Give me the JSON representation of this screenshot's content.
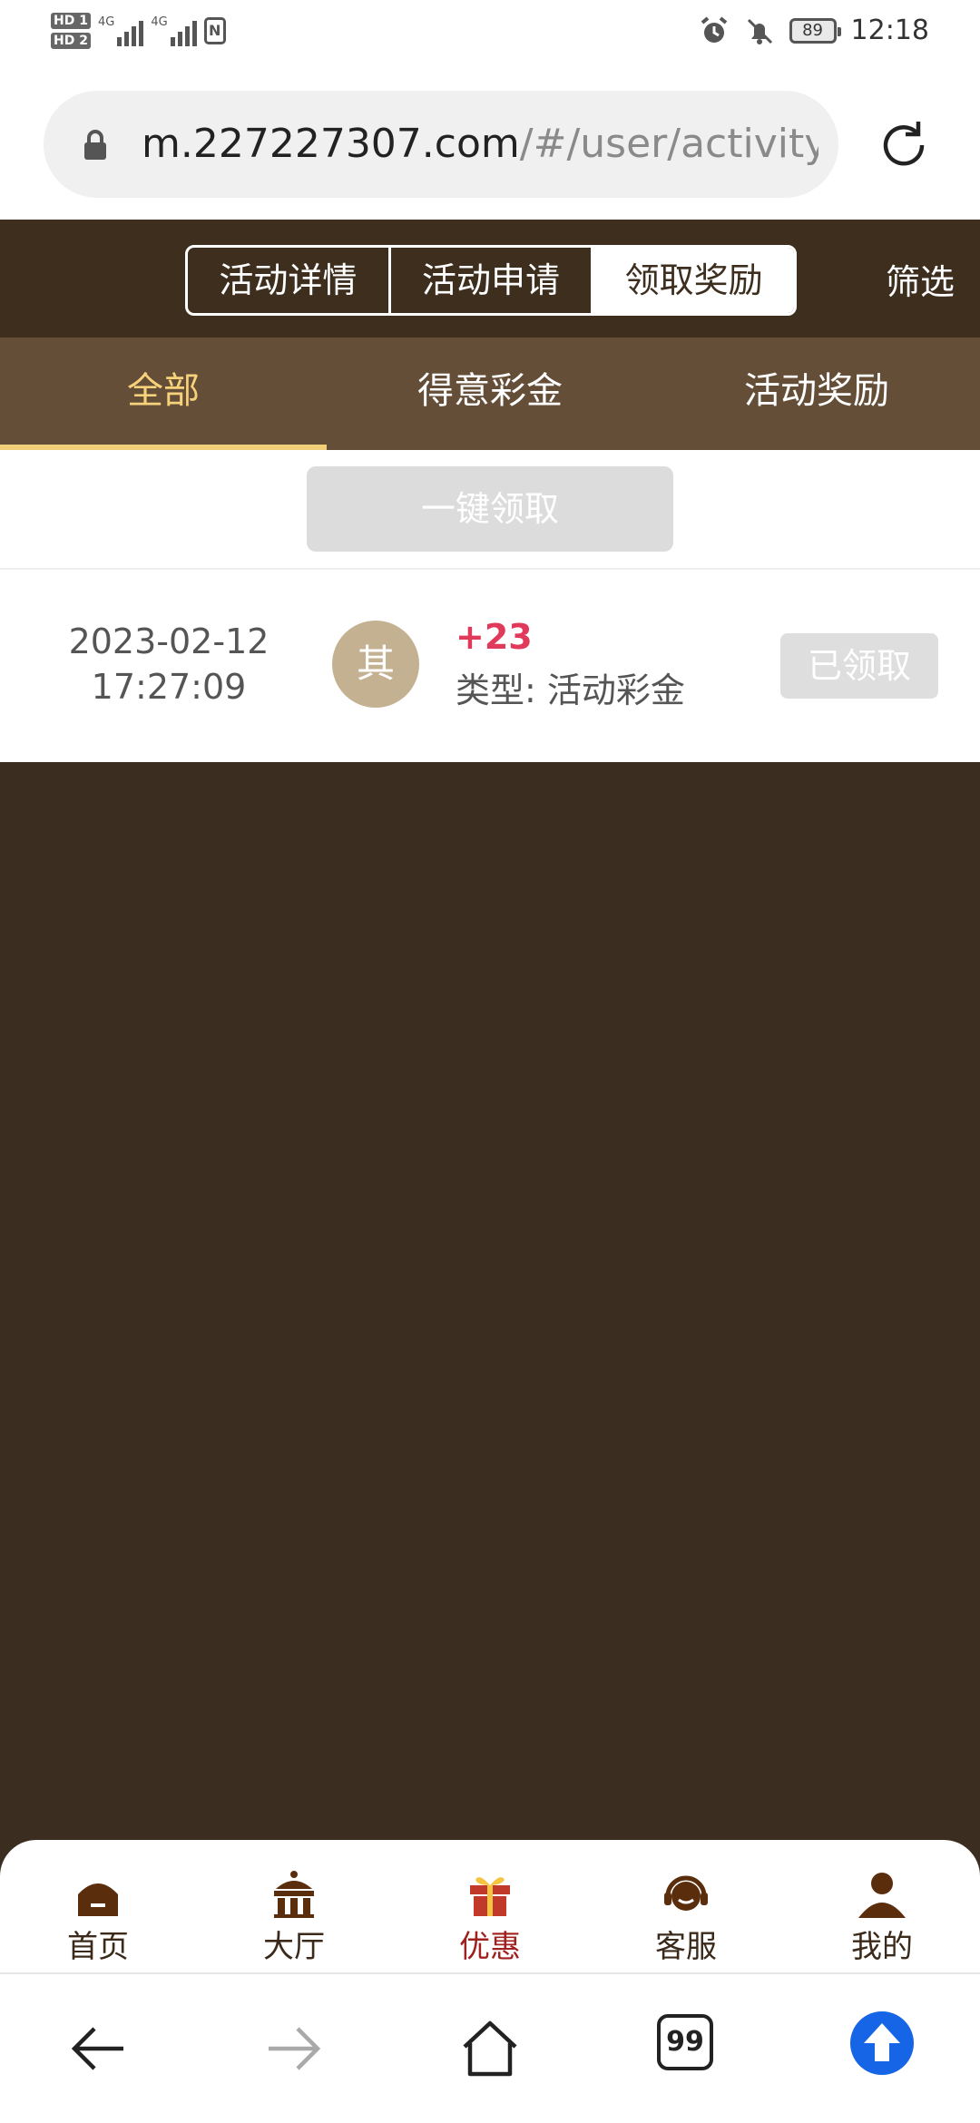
{
  "status_bar": {
    "sim1": "HD 1",
    "sim2": "HD 2",
    "network1": "4G",
    "network2": "4G",
    "battery": "89",
    "time": "12:18"
  },
  "browser": {
    "url_host": "m.227227307.com",
    "url_path": "/#/user/activity("
  },
  "header": {
    "segments": [
      "活动详情",
      "活动申请",
      "领取奖励"
    ],
    "active_segment": "领取奖励",
    "filter_label": "筛选"
  },
  "subtabs": {
    "items": [
      "全部",
      "得意彩金",
      "活动奖励"
    ],
    "active": "全部"
  },
  "claim_all_label": "一键领取",
  "records": [
    {
      "date": "2023-02-12",
      "time": "17:27:09",
      "avatar_char": "其",
      "amount": "+23",
      "type": "类型: 活动彩金",
      "status": "已领取"
    }
  ],
  "app_nav": {
    "items": [
      {
        "label": "首页",
        "icon": "home-icon"
      },
      {
        "label": "大厅",
        "icon": "hall-icon"
      },
      {
        "label": "优惠",
        "icon": "gift-icon"
      },
      {
        "label": "客服",
        "icon": "headset-icon"
      },
      {
        "label": "我的",
        "icon": "person-icon"
      }
    ],
    "active": "优惠"
  },
  "browser_nav": {
    "tabs_count": "99"
  },
  "colors": {
    "header_bg": "#3d2e1e",
    "subtab_bg": "#654e38",
    "active_tab_text": "#f6d27b",
    "amount_color": "#e0395a",
    "page_bg": "#3b2e20"
  }
}
